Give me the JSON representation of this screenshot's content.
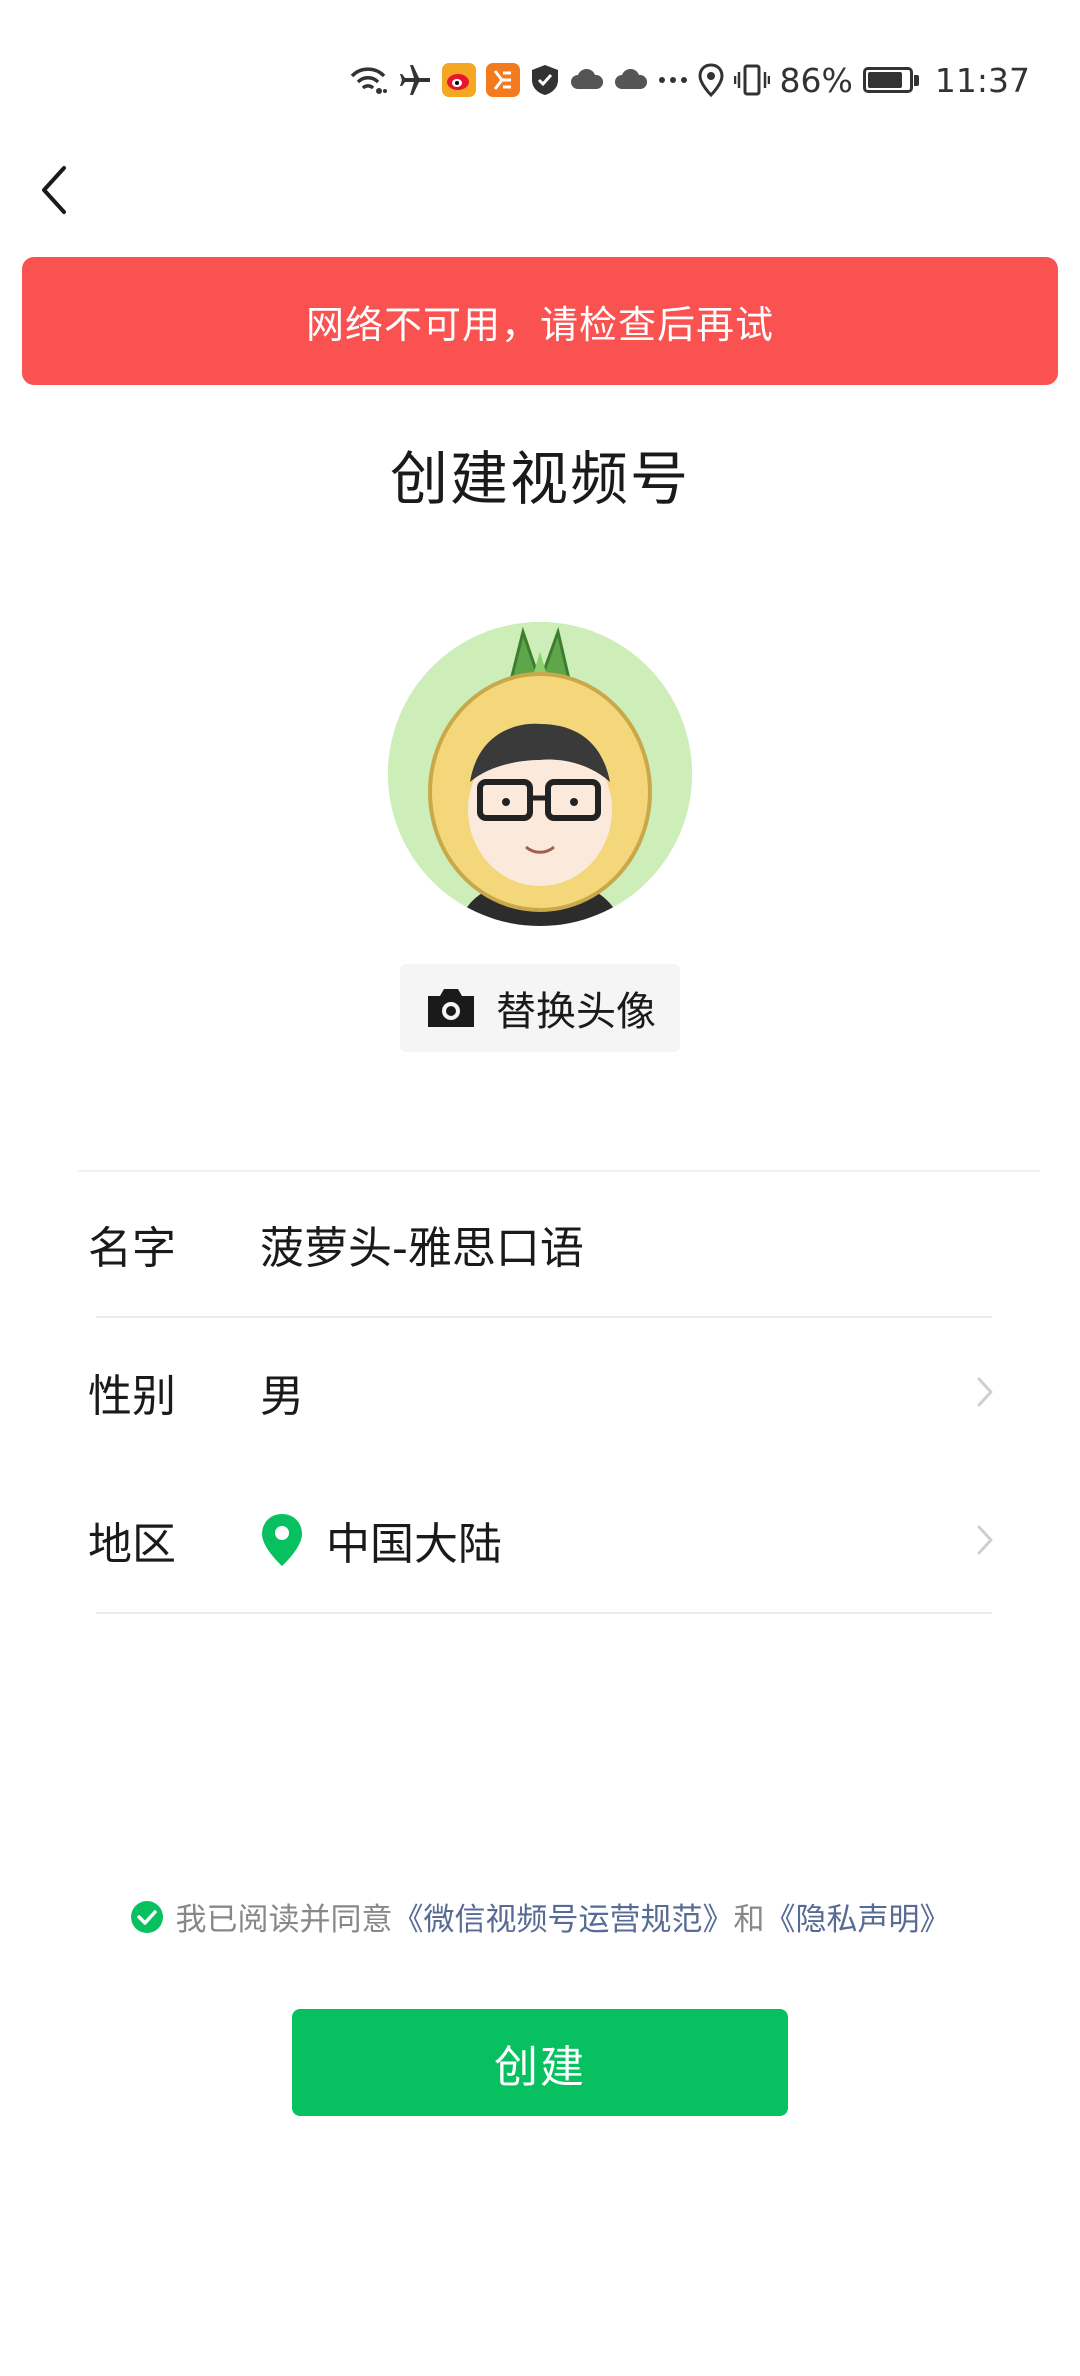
{
  "status_bar": {
    "battery_text": "86%",
    "battery_level": 0.86,
    "time": "11:37",
    "icons": [
      "wifi-icon",
      "airplane-icon",
      "weibo-icon",
      "app-icon",
      "shield-icon",
      "cloud-icon",
      "cloud-icon",
      "more-icon",
      "location-icon",
      "vibrate-icon",
      "battery-icon"
    ]
  },
  "banner": {
    "text": "网络不可用，请检查后再试",
    "color": "#fa5151"
  },
  "page": {
    "title": "创建视频号"
  },
  "avatar": {
    "change_label": "替换头像"
  },
  "form": {
    "name": {
      "label": "名字",
      "value": "菠萝头-雅思口语"
    },
    "gender": {
      "label": "性别",
      "value": "男"
    },
    "region": {
      "label": "地区",
      "value": "中国大陆"
    }
  },
  "agreement": {
    "prefix": "我已阅读并同意",
    "link1": "《微信视频号运营规范》",
    "conjunction": "和",
    "link2": "《隐私声明》"
  },
  "create_button": {
    "label": "创建",
    "color": "#07c160"
  },
  "colors": {
    "accent": "#07c160",
    "link": "#576b95",
    "error": "#fa5151"
  }
}
